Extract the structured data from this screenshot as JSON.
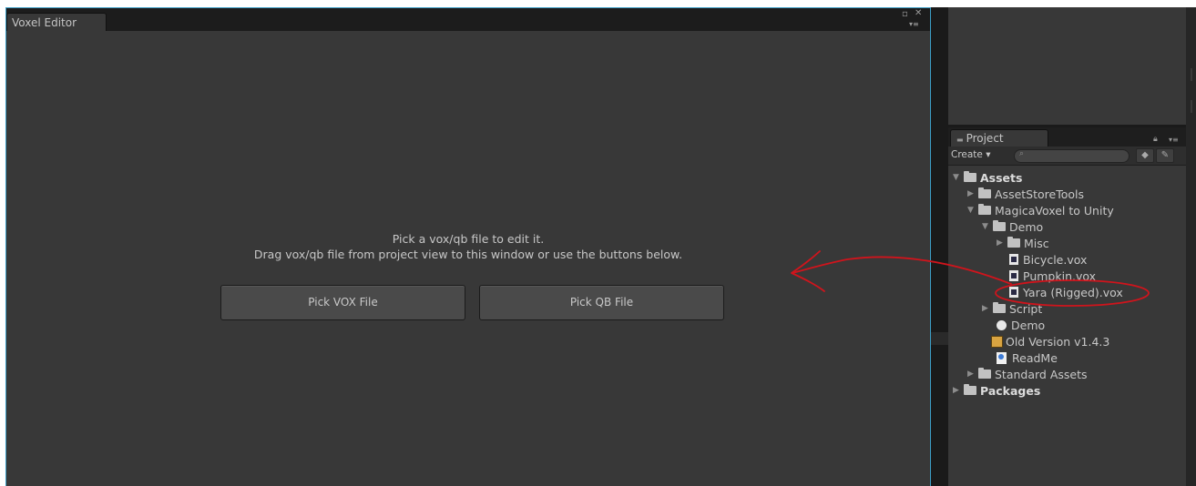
{
  "editor": {
    "tab_title": "Voxel Editor",
    "window_controls": {
      "maximize": "▫",
      "close": "✕",
      "menu": "▾≡"
    },
    "prompt_line1": "Pick a vox/qb file to edit it.",
    "prompt_line2": "Drag vox/qb file from project view to this window or use the buttons below.",
    "pick_vox_label": "Pick VOX File",
    "pick_qb_label": "Pick QB File"
  },
  "project": {
    "tab_title": "Project",
    "create_label": "Create ▾",
    "tree": [
      {
        "label": "Assets",
        "bold": true,
        "arrow": "▼",
        "icon": "folder"
      },
      {
        "label": "AssetStoreTools",
        "arrow": "▶",
        "icon": "folder"
      },
      {
        "label": "MagicaVoxel to Unity",
        "arrow": "▼",
        "icon": "folder"
      },
      {
        "label": "Demo",
        "arrow": "▼",
        "icon": "folder"
      },
      {
        "label": "Misc",
        "arrow": "▶",
        "icon": "folder"
      },
      {
        "label": "Bicycle.vox",
        "icon": "vox"
      },
      {
        "label": "Pumpkin.vox",
        "icon": "vox"
      },
      {
        "label": "Yara (Rigged).vox",
        "icon": "vox"
      },
      {
        "label": "Script",
        "arrow": "▶",
        "icon": "folder"
      },
      {
        "label": "Demo",
        "icon": "unity"
      },
      {
        "label": "Old Version v1.4.3",
        "icon": "package"
      },
      {
        "label": "ReadMe",
        "icon": "readme"
      },
      {
        "label": "Standard Assets",
        "arrow": "▶",
        "icon": "folder"
      },
      {
        "label": "Packages",
        "bold": true,
        "arrow": "▶",
        "icon": "folder"
      }
    ]
  },
  "annotation_color": "#d0141c",
  "accent_border": "#3b9ec6"
}
